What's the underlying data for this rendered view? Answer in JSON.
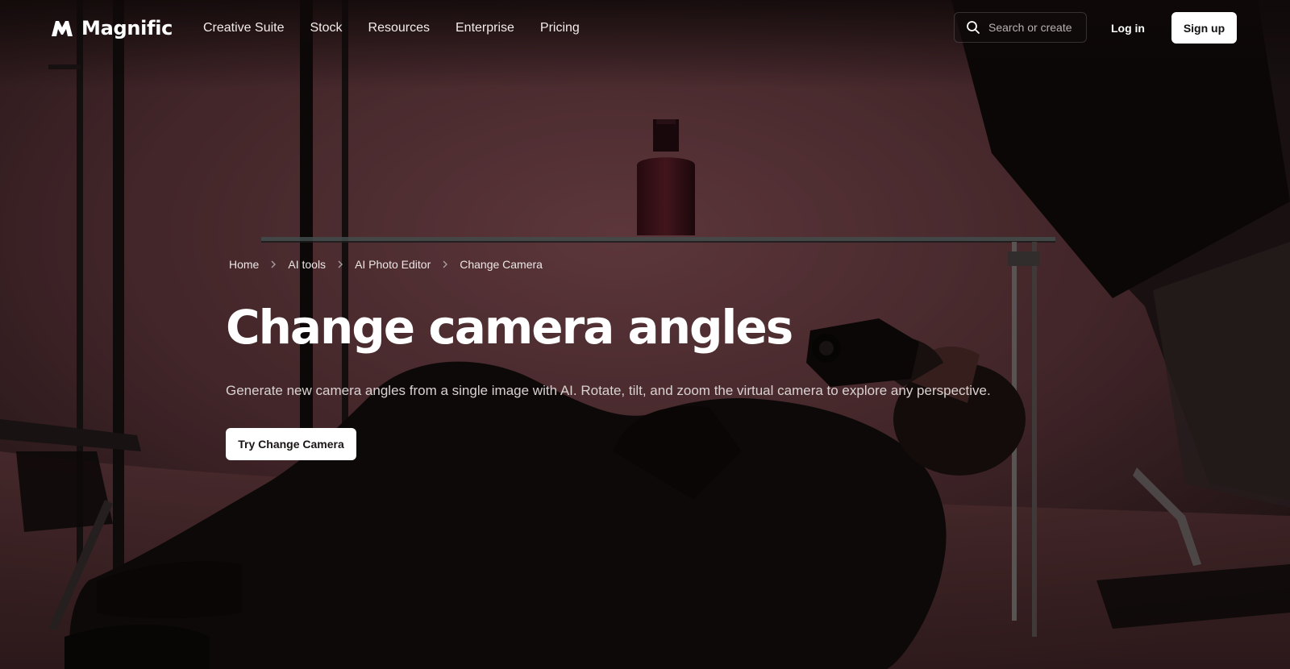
{
  "brand": {
    "name": "Magnific"
  },
  "nav": {
    "links": [
      "Creative Suite",
      "Stock",
      "Resources",
      "Enterprise",
      "Pricing"
    ],
    "search_placeholder": "Search or create",
    "login_label": "Log in",
    "signup_label": "Sign up"
  },
  "breadcrumb": [
    "Home",
    "AI tools",
    "AI Photo Editor",
    "Change Camera"
  ],
  "hero": {
    "title": "Change camera angles",
    "subtitle": "Generate new camera angles from a single image with AI. Rotate, tilt, and zoom the virtual camera to explore any perspective.",
    "cta_label": "Try Change Camera",
    "background": "photographer-lying-on-floor-shooting-perfume-bottle"
  },
  "icons": {
    "logo": "magnific-logo-icon",
    "search": "search-icon",
    "breadcrumb_separator": "chevron-right-icon"
  },
  "colors": {
    "background_dark": "#1a0f10",
    "backdrop_pink": "#6e4146",
    "button_bg": "#ffffff",
    "text_primary": "#ffffff"
  }
}
